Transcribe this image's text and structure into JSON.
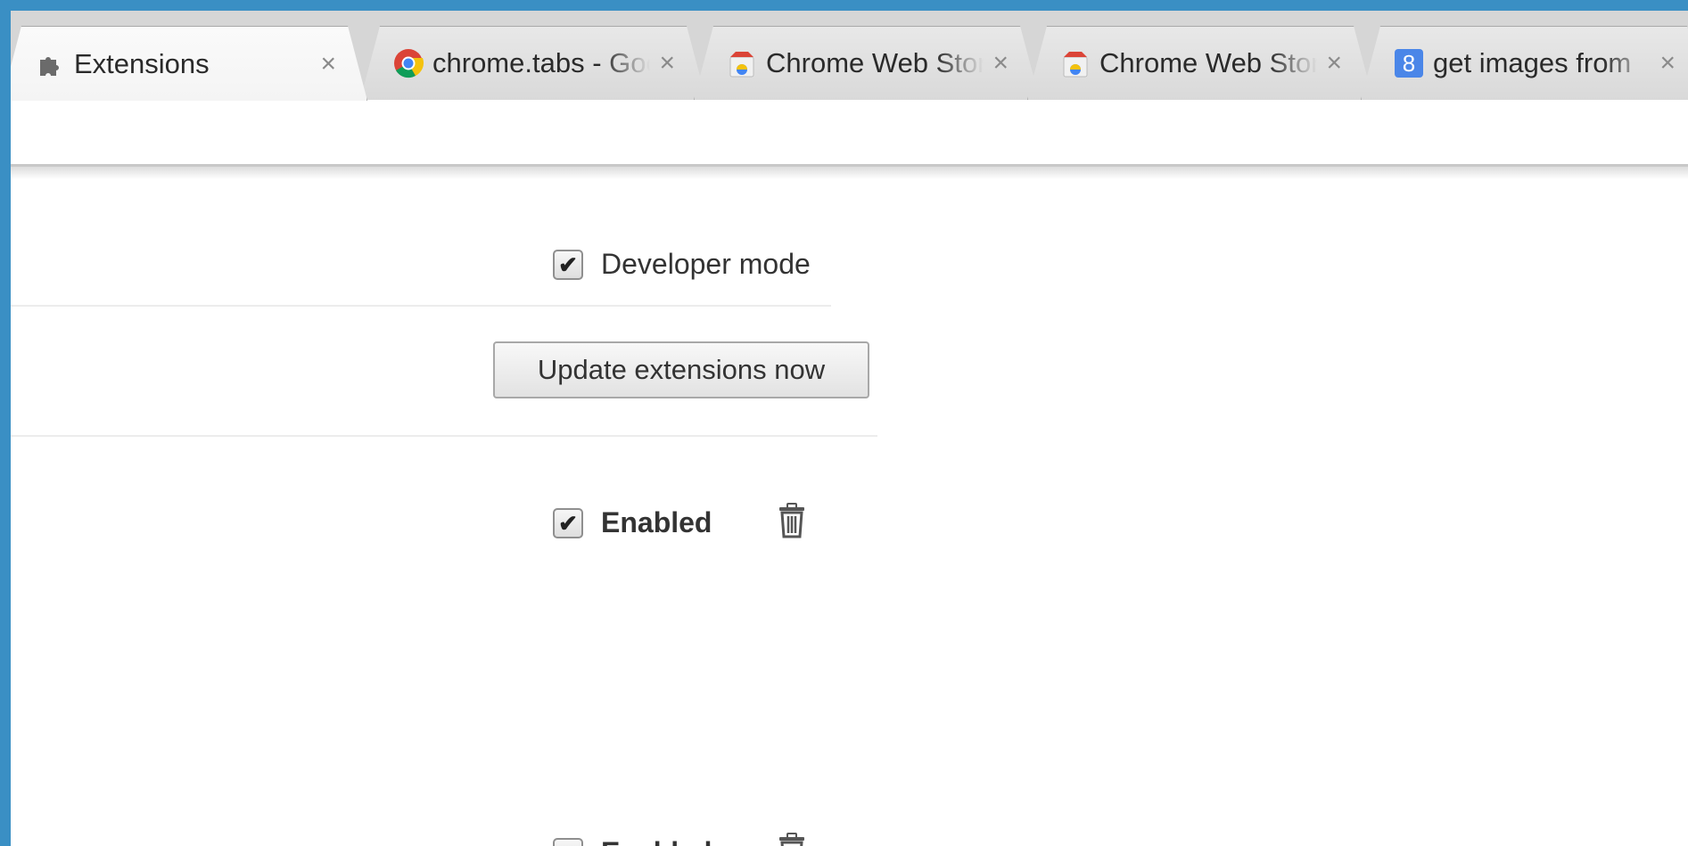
{
  "tabs": [
    {
      "title": "Extensions",
      "close": "×",
      "icon": "puzzle-icon",
      "active": true
    },
    {
      "title": "chrome.tabs - Google Chrome",
      "close": "×",
      "icon": "chrome-icon",
      "active": false
    },
    {
      "title": "Chrome Web Store",
      "close": "×",
      "icon": "web-store-icon",
      "active": false
    },
    {
      "title": "Chrome Web Store",
      "close": "×",
      "icon": "web-store-icon",
      "active": false
    },
    {
      "title": "get images from",
      "close": "×",
      "icon": "google-icon",
      "active": false
    }
  ],
  "content": {
    "developer_mode": {
      "label": "Developer mode",
      "checked": true,
      "check_glyph": "✔"
    },
    "update_button": "Update extensions now",
    "extensions": [
      {
        "enabled_label": "Enabled",
        "checked": true,
        "check_glyph": "✔"
      },
      {
        "enabled_label": "Enabled",
        "checked": true,
        "check_glyph": "✔"
      }
    ]
  },
  "colors": {
    "desktop": "#3a8fc4",
    "tabstrip": "#d6d6d6",
    "google_blue": "#4a86e8"
  }
}
